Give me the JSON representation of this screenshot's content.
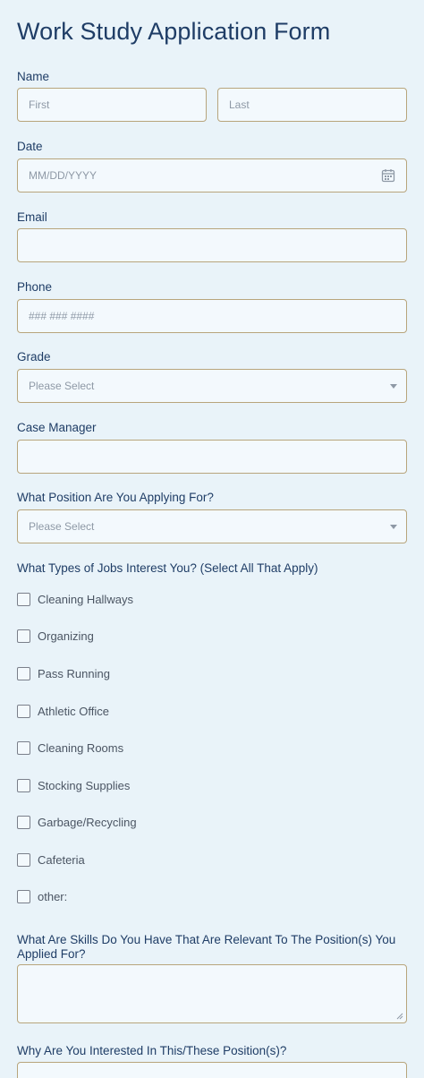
{
  "form": {
    "title": "Work Study Application Form",
    "name": {
      "label": "Name",
      "first_placeholder": "First",
      "last_placeholder": "Last"
    },
    "date": {
      "label": "Date",
      "placeholder": "MM/DD/YYYY",
      "icon": "calendar-icon"
    },
    "email": {
      "label": "Email",
      "value": ""
    },
    "phone": {
      "label": "Phone",
      "placeholder": "### ### ####"
    },
    "grade": {
      "label": "Grade",
      "selected": "Please Select"
    },
    "case_manager": {
      "label": "Case Manager",
      "value": ""
    },
    "position": {
      "label": "What Position Are You Applying For?",
      "selected": "Please Select"
    },
    "jobs": {
      "label": "What Types of Jobs Interest You? (Select All That Apply)",
      "options": [
        "Cleaning Hallways",
        "Organizing",
        "Pass Running",
        "Athletic Office",
        "Cleaning Rooms",
        "Stocking Supplies",
        "Garbage/Recycling",
        "Cafeteria",
        "other:"
      ]
    },
    "skills": {
      "label_line1": "What Are Skills Do You Have That Are Relevant To The Position(s) You",
      "label_line2": "Applied For?"
    },
    "interest": {
      "label": "Why Are You Interested In This/These Position(s)?"
    }
  },
  "colors": {
    "background": "#e9f3f9",
    "title": "#1f3d66",
    "border": "#b8a57c"
  }
}
